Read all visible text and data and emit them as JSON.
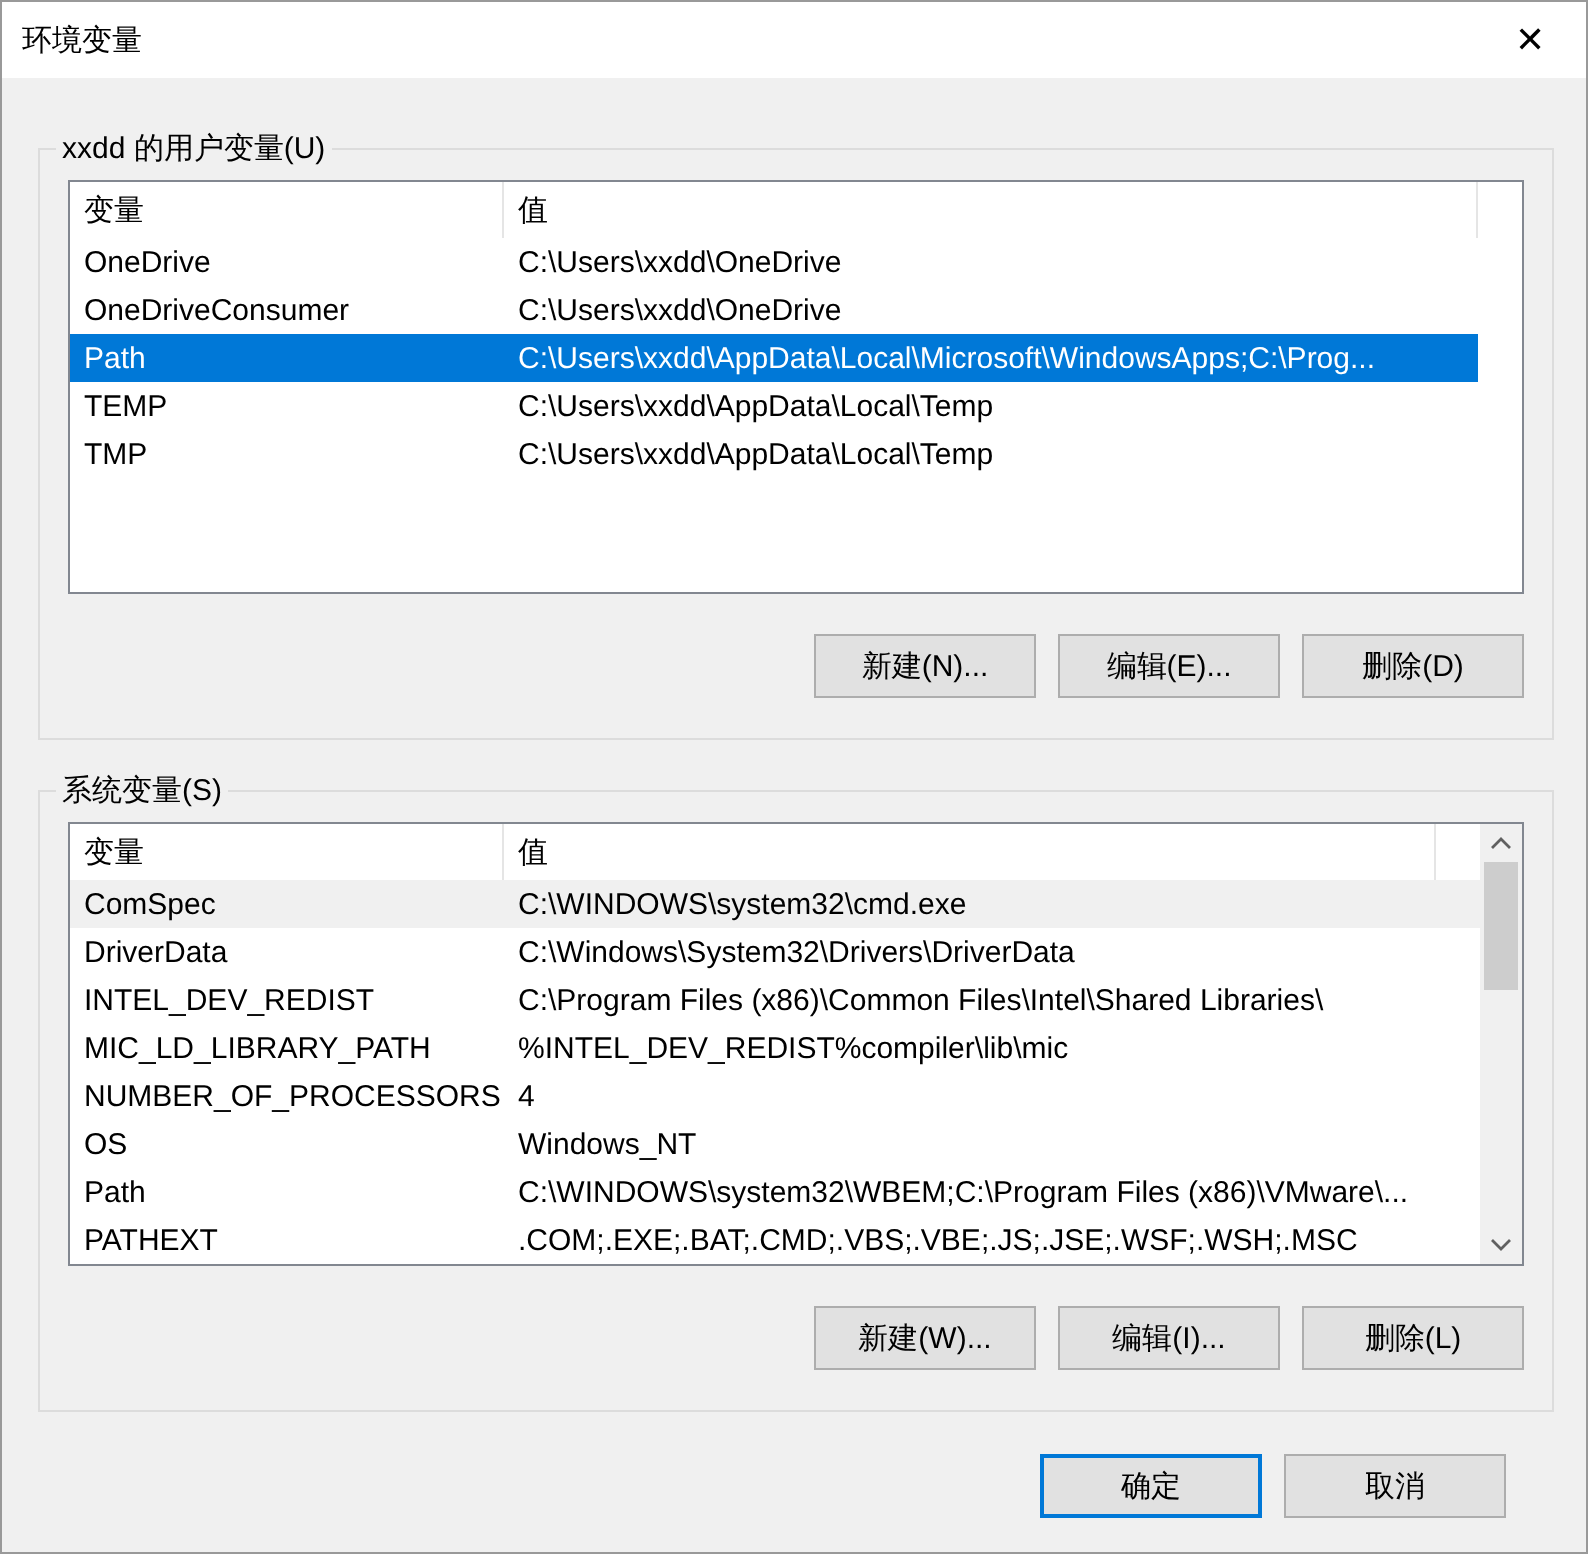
{
  "window": {
    "title": "环境变量",
    "close": "✕"
  },
  "user_vars": {
    "label": "xxdd 的用户变量(U)",
    "columns": [
      "变量",
      "值"
    ],
    "rows": [
      {
        "name": "OneDrive",
        "value": "C:\\Users\\xxdd\\OneDrive",
        "selected": false,
        "hovered": false
      },
      {
        "name": "OneDriveConsumer",
        "value": "C:\\Users\\xxdd\\OneDrive",
        "selected": false,
        "hovered": false
      },
      {
        "name": "Path",
        "value": "C:\\Users\\xxdd\\AppData\\Local\\Microsoft\\WindowsApps;C:\\Prog...",
        "selected": true,
        "hovered": false
      },
      {
        "name": "TEMP",
        "value": "C:\\Users\\xxdd\\AppData\\Local\\Temp",
        "selected": false,
        "hovered": false
      },
      {
        "name": "TMP",
        "value": "C:\\Users\\xxdd\\AppData\\Local\\Temp",
        "selected": false,
        "hovered": false
      }
    ],
    "scrollbar": false,
    "buttons": [
      "新建(N)...",
      "编辑(E)...",
      "删除(D)"
    ]
  },
  "system_vars": {
    "label": "系统变量(S)",
    "columns": [
      "变量",
      "值"
    ],
    "rows": [
      {
        "name": "ComSpec",
        "value": "C:\\WINDOWS\\system32\\cmd.exe",
        "selected": false,
        "hovered": true
      },
      {
        "name": "DriverData",
        "value": "C:\\Windows\\System32\\Drivers\\DriverData",
        "selected": false,
        "hovered": false
      },
      {
        "name": "INTEL_DEV_REDIST",
        "value": "C:\\Program Files (x86)\\Common Files\\Intel\\Shared Libraries\\",
        "selected": false,
        "hovered": false
      },
      {
        "name": "MIC_LD_LIBRARY_PATH",
        "value": "%INTEL_DEV_REDIST%compiler\\lib\\mic",
        "selected": false,
        "hovered": false
      },
      {
        "name": "NUMBER_OF_PROCESSORS",
        "value": "4",
        "selected": false,
        "hovered": false
      },
      {
        "name": "OS",
        "value": "Windows_NT",
        "selected": false,
        "hovered": false
      },
      {
        "name": "Path",
        "value": "C:\\WINDOWS\\system32\\WBEM;C:\\Program Files (x86)\\VMware\\...",
        "selected": false,
        "hovered": false
      },
      {
        "name": "PATHEXT",
        "value": ".COM;.EXE;.BAT;.CMD;.VBS;.VBE;.JS;.JSE;.WSF;.WSH;.MSC",
        "selected": false,
        "hovered": false
      }
    ],
    "scrollbar": true,
    "buttons": [
      "新建(W)...",
      "编辑(I)...",
      "删除(L)"
    ]
  },
  "footer": [
    {
      "label": "确定",
      "default": true
    },
    {
      "label": "取消",
      "default": false
    }
  ]
}
